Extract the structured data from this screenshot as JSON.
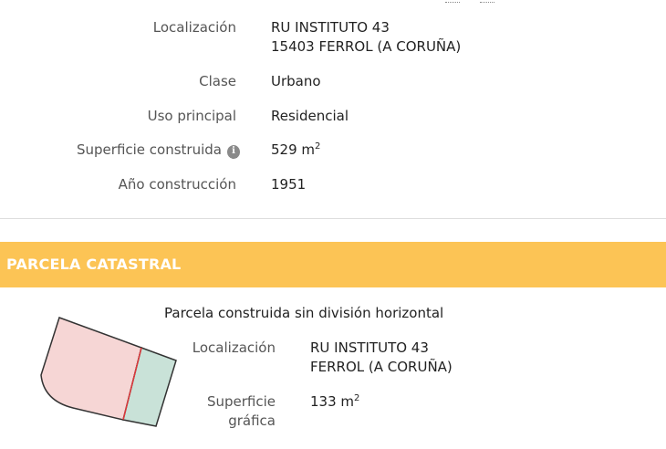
{
  "details": {
    "localizacion_label": "Localización",
    "localizacion_line1": "RU INSTITUTO 43",
    "localizacion_line2": "15403 FERROL (A CORUÑA)",
    "clase_label": "Clase",
    "clase_value": "Urbano",
    "uso_label": "Uso principal",
    "uso_value": "Residencial",
    "superficie_label": "Superficie construida",
    "superficie_value": "529 m",
    "superficie_unit_sup": "2",
    "ano_label": "Año construcción",
    "ano_value": "1951"
  },
  "parcela": {
    "section_title": "PARCELA CATASTRAL",
    "type_text": "Parcela construida sin división horizontal",
    "localizacion_label": "Localización",
    "localizacion_line1": "RU INSTITUTO 43",
    "localizacion_line2": "FERROL (A CORUÑA)",
    "superficie_label_line1": "Superficie",
    "superficie_label_line2": "gráfica",
    "superficie_value": "133 m",
    "superficie_unit_sup": "2",
    "sketch_colors": {
      "built": "#f6d6d5",
      "unbuilt": "#c9e2d8",
      "outline": "#333333",
      "division": "#e0383b"
    }
  },
  "colors": {
    "section_header_bg": "#fcc455"
  },
  "icons": {
    "info": "info-circle-icon"
  }
}
